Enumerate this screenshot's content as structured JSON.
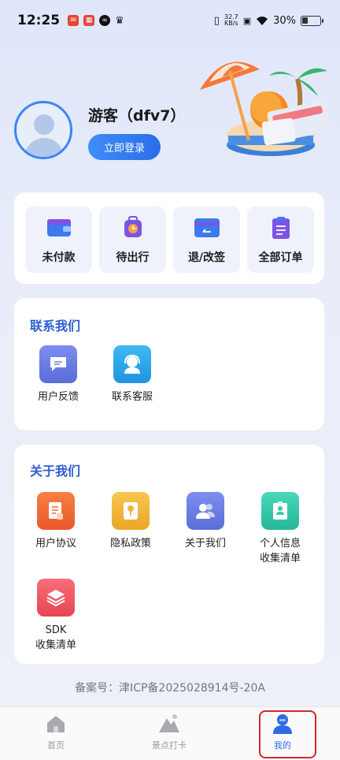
{
  "status_bar": {
    "time": "12:25",
    "net_speed_top": "32.7",
    "net_speed_bottom": "KB/s",
    "battery": "30%"
  },
  "profile": {
    "username": "游客（dfv7）",
    "login_label": "立即登录"
  },
  "orders": [
    {
      "label": "未付款",
      "icon": "wallet-icon"
    },
    {
      "label": "待出行",
      "icon": "luggage-icon"
    },
    {
      "label": "退/改签",
      "icon": "card-return-icon"
    },
    {
      "label": "全部订单",
      "icon": "clipboard-icon"
    }
  ],
  "contact": {
    "title": "联系我们",
    "items": [
      {
        "label": "用户反馈",
        "icon": "chat-icon",
        "color": "#6f7fe0"
      },
      {
        "label": "联系客服",
        "icon": "headset-icon",
        "color": "#2fa6ea"
      }
    ]
  },
  "about": {
    "title": "关于我们",
    "items": [
      {
        "label": "用户协议",
        "icon": "agreement-icon",
        "color": "#f06a36"
      },
      {
        "label": "隐私政策",
        "icon": "lock-icon",
        "color": "#f1b63b"
      },
      {
        "label": "关于我们",
        "icon": "people-icon",
        "color": "#6d7ee3"
      },
      {
        "label": "个人信息\n收集清单",
        "icon": "id-card-icon",
        "color": "#37c9ab"
      },
      {
        "label": "SDK\n收集清单",
        "icon": "layers-icon",
        "color": "#ef5a66"
      }
    ]
  },
  "icp": "备案号：津ICP备2025028914号-20A",
  "tabs": [
    {
      "label": "首页",
      "icon": "home-icon"
    },
    {
      "label": "景点打卡",
      "icon": "mountain-icon"
    },
    {
      "label": "我的",
      "icon": "user-icon",
      "active": true
    }
  ],
  "colors": {
    "accent": "#2f6ae6",
    "section_title": "#2f5ed0",
    "highlight": "#d9262a"
  }
}
